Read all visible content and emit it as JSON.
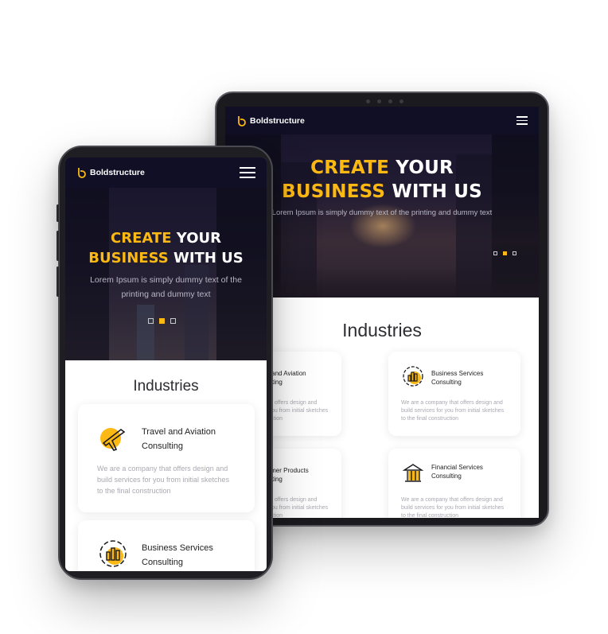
{
  "brand": {
    "name": "Boldstructure",
    "accent_color": "#fdb913",
    "nav_color": "#110f26"
  },
  "hero": {
    "title_part1": "CREATE",
    "title_part2": "YOUR",
    "title_part3": "BUSINESS",
    "title_part4": "WITH US",
    "tablet_subtitle": "Lorem Ipsum is simply dummy text of the printing and dummy text",
    "phone_subtitle": "Lorem Ipsum is simply dummy text of the printing and dummy text",
    "slide_count": 3,
    "active_slide": 2
  },
  "industries": {
    "heading": "Industries",
    "description": "We are a company that offers design and build services for you from initial sketches to the final construction",
    "tablet_description": "are a company that offers design and build services for you from initial sketches to the final construction",
    "items": [
      {
        "label_line1": "Travel and Aviation",
        "label_line2": "Consulting",
        "icon": "airplane-icon"
      },
      {
        "label_line1": "Business Services",
        "label_line2": "Consulting",
        "icon": "chart-icon"
      },
      {
        "label_line1": "Consumer Products",
        "label_line2": "Consulting",
        "icon": "cart-icon"
      },
      {
        "label_line1": "Financial Services",
        "label_line2": "Consulting",
        "icon": "bank-icon"
      }
    ]
  }
}
